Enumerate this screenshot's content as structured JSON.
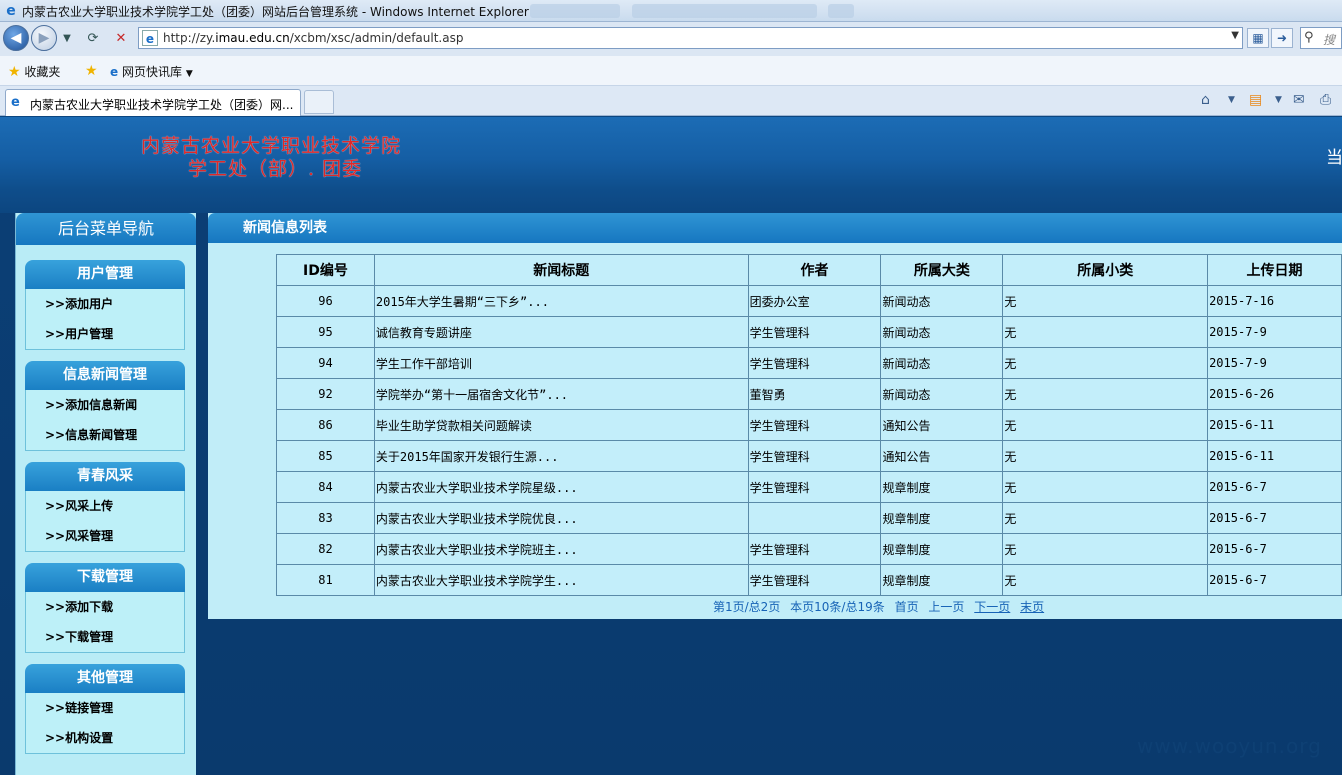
{
  "window": {
    "title": "内蒙古农业大学职业技术学院学工处（团委）网站后台管理系统 - Windows Internet Explorer"
  },
  "address": {
    "url_prefix": "http://zy.",
    "url_host": "imau.edu.cn",
    "url_path": "/xcbm/xsc/admin/default.asp",
    "search_placeholder": "搜"
  },
  "favorites": {
    "favorites_label": "收藏夹",
    "webslice_label": "网页快讯库"
  },
  "tabs": {
    "active_label": "内蒙古农业大学职业技术学院学工处（团委）网..."
  },
  "banner": {
    "line1": "内蒙古农业大学职业技术学院",
    "line2": "学工处（部）. 团委",
    "right_text": "当"
  },
  "sidebar": {
    "title": "后台菜单导航",
    "groups": [
      {
        "head": "用户管理",
        "items": [
          ">>添加用户",
          ">>用户管理"
        ]
      },
      {
        "head": "信息新闻管理",
        "items": [
          ">>添加信息新闻",
          ">>信息新闻管理"
        ]
      },
      {
        "head": "青春风采",
        "items": [
          ">>风采上传",
          ">>风采管理"
        ]
      },
      {
        "head": "下载管理",
        "items": [
          ">>添加下载",
          ">>下载管理"
        ]
      },
      {
        "head": "其他管理",
        "items": [
          ">>链接管理",
          ">>机构设置"
        ]
      }
    ]
  },
  "main": {
    "header": "新闻信息列表",
    "columns": [
      "ID编号",
      "新闻标题",
      "作者",
      "所属大类",
      "所属小类",
      "上传日期"
    ],
    "rows": [
      [
        "96",
        "2015年大学生暑期“三下乡”...",
        "团委办公室",
        "新闻动态",
        "无",
        "2015-7-16"
      ],
      [
        "95",
        "诚信教育专题讲座",
        "学生管理科",
        "新闻动态",
        "无",
        "2015-7-9"
      ],
      [
        "94",
        "学生工作干部培训",
        "学生管理科",
        "新闻动态",
        "无",
        "2015-7-9"
      ],
      [
        "92",
        "学院举办“第十一届宿舍文化节”...",
        "董智勇",
        "新闻动态",
        "无",
        "2015-6-26"
      ],
      [
        "86",
        "毕业生助学贷款相关问题解读",
        "学生管理科",
        "通知公告",
        "无",
        "2015-6-11"
      ],
      [
        "85",
        "关于2015年国家开发银行生源...",
        "学生管理科",
        "通知公告",
        "无",
        "2015-6-11"
      ],
      [
        "84",
        "内蒙古农业大学职业技术学院星级...",
        "学生管理科",
        "规章制度",
        "无",
        "2015-6-7"
      ],
      [
        "83",
        "内蒙古农业大学职业技术学院优良...",
        "",
        "规章制度",
        "无",
        "2015-6-7"
      ],
      [
        "82",
        "内蒙古农业大学职业技术学院班主...",
        "学生管理科",
        "规章制度",
        "无",
        "2015-6-7"
      ],
      [
        "81",
        "内蒙古农业大学职业技术学院学生...",
        "学生管理科",
        "规章制度",
        "无",
        "2015-6-7"
      ]
    ],
    "pager": {
      "page_info": "第1页/总2页",
      "count_info": "本页10条/总19条",
      "first": "首页",
      "prev": "上一页",
      "next": "下一页",
      "last": "末页"
    }
  },
  "watermark": "www.wooyun.org"
}
